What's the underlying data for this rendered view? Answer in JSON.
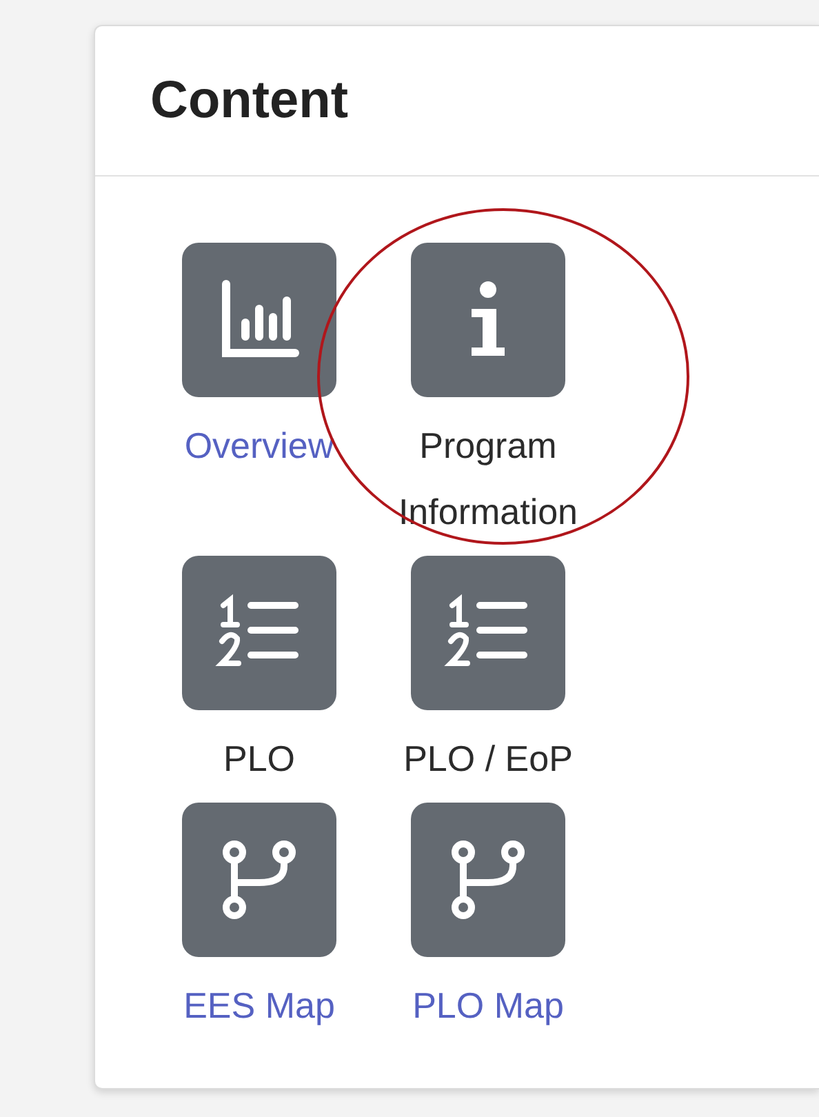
{
  "card": {
    "title": "Content"
  },
  "items": [
    {
      "label": "Overview",
      "kind": "chart",
      "link": true,
      "highlighted": false
    },
    {
      "label": "Program Information",
      "kind": "info",
      "link": false,
      "highlighted": true
    },
    {
      "label": "PLO",
      "kind": "list",
      "link": false,
      "highlighted": false
    },
    {
      "label": "PLO / EoP",
      "kind": "list",
      "link": false,
      "highlighted": false
    },
    {
      "label": "EES Map",
      "kind": "branch",
      "link": true,
      "highlighted": false
    },
    {
      "label": "PLO Map",
      "kind": "branch",
      "link": true,
      "highlighted": false
    }
  ]
}
